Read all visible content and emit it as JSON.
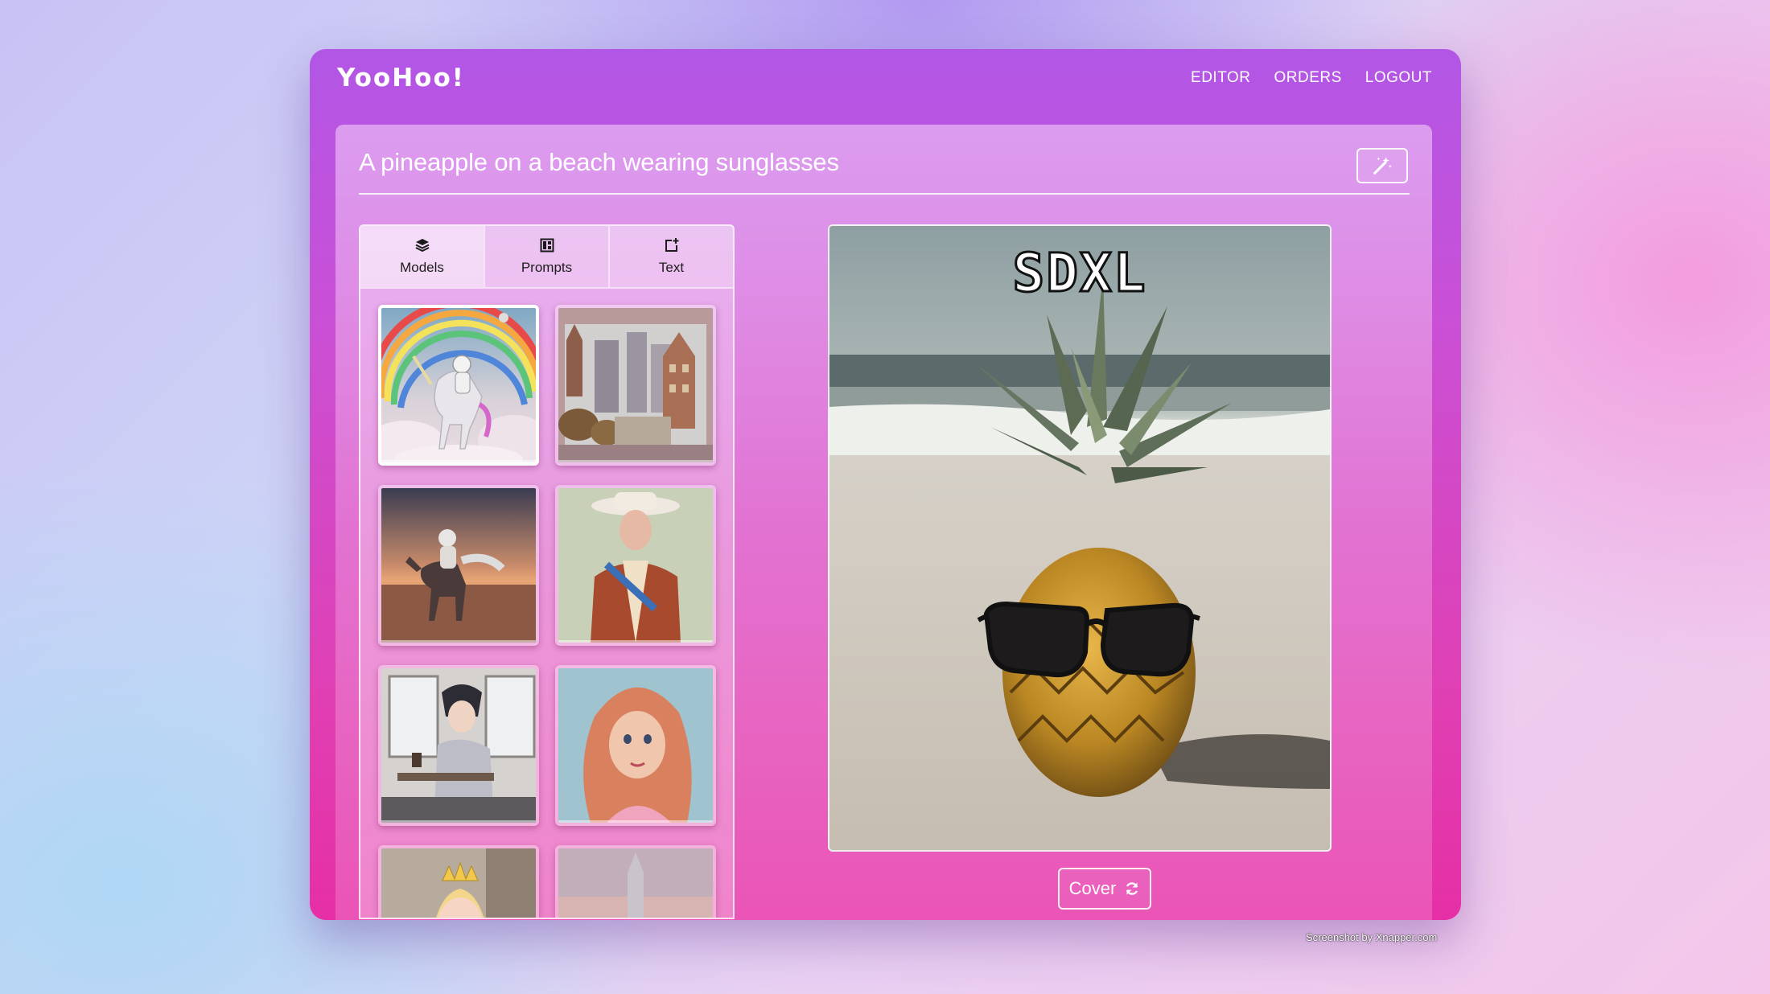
{
  "app": {
    "logo": "YooHoo!"
  },
  "nav": {
    "items": [
      "EDITOR",
      "ORDERS",
      "LOGOUT"
    ]
  },
  "prompt": {
    "value": "A pineapple on a beach wearing sunglasses",
    "magic_icon": "magic-wand-icon"
  },
  "sidebar": {
    "tabs": [
      {
        "label": "Models",
        "icon": "layers-icon",
        "active": true
      },
      {
        "label": "Prompts",
        "icon": "layout-icon",
        "active": false
      },
      {
        "label": "Text",
        "icon": "text-add-icon",
        "active": false
      }
    ],
    "thumbnails": [
      {
        "subject": "astronaut-unicorn-rainbow",
        "selected": true
      },
      {
        "subject": "city-buildings",
        "selected": false
      },
      {
        "subject": "astronaut-horse-desert",
        "selected": false
      },
      {
        "subject": "colonial-portrait",
        "selected": false
      },
      {
        "subject": "anime-cafe",
        "selected": false
      },
      {
        "subject": "cartoon-mermaid",
        "selected": false
      },
      {
        "subject": "cartoon-princess",
        "selected": false
      },
      {
        "subject": "rocket-launch",
        "selected": false
      }
    ]
  },
  "preview": {
    "overlay_text": "SDXL"
  },
  "actions": {
    "cover_label": "Cover"
  },
  "credit": "Screenshot by Xnapper.com",
  "colors": {
    "accent": "#c950d6",
    "accent_end": "#e62fa6",
    "text": "#ffffff"
  }
}
